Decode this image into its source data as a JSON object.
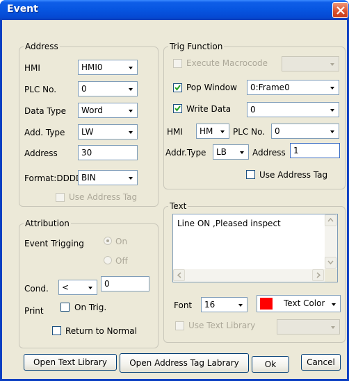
{
  "window": {
    "title": "Event"
  },
  "address": {
    "legend": "Address",
    "hmi_label": "HMI",
    "hmi_value": "HMI0",
    "plc_no_label": "PLC No.",
    "plc_no_value": "0",
    "data_type_label": "Data Type",
    "data_type_value": "Word",
    "add_type_label": "Add. Type",
    "add_type_value": "LW",
    "address_label": "Address",
    "address_value": "30",
    "format_label": "Format:DDDD",
    "format_value": "BIN",
    "use_address_tag": "Use Address Tag"
  },
  "trig": {
    "legend": "Trig Function",
    "execute_macrocode": "Execute Macrocode",
    "pop_window": "Pop Window",
    "pop_window_value": "0:Frame0",
    "write_data": "Write Data",
    "write_data_value": "0",
    "hmi_label": "HMI",
    "hmi_value": "HM",
    "plc_no_label": "PLC No.",
    "plc_no_value": "0",
    "addr_type_label": "Addr.Type",
    "addr_type_value": "LB",
    "address_label": "Address",
    "address_value": "1",
    "use_address_tag": "Use Address Tag"
  },
  "attribution": {
    "legend": "Attribution",
    "event_trigging": "Event Trigging",
    "on": "On",
    "off": "Off",
    "cond_label": "Cond.",
    "cond_op": "<",
    "cond_value": "0",
    "print_label": "Print",
    "on_trig": "On Trig.",
    "return_to_normal": "Return to Normal"
  },
  "text": {
    "legend": "Text",
    "content": "Line ON ,Pleased inspect",
    "font_label": "Font",
    "font_value": "16",
    "text_color": "Text Color",
    "color_swatch": "#ff0000",
    "use_text_library": "Use Text Library"
  },
  "buttons": {
    "open_text_library": "Open Text Library",
    "open_address_tag_library": "Open Address Tag Labrary",
    "ok": "Ok",
    "cancel": "Cancel"
  }
}
